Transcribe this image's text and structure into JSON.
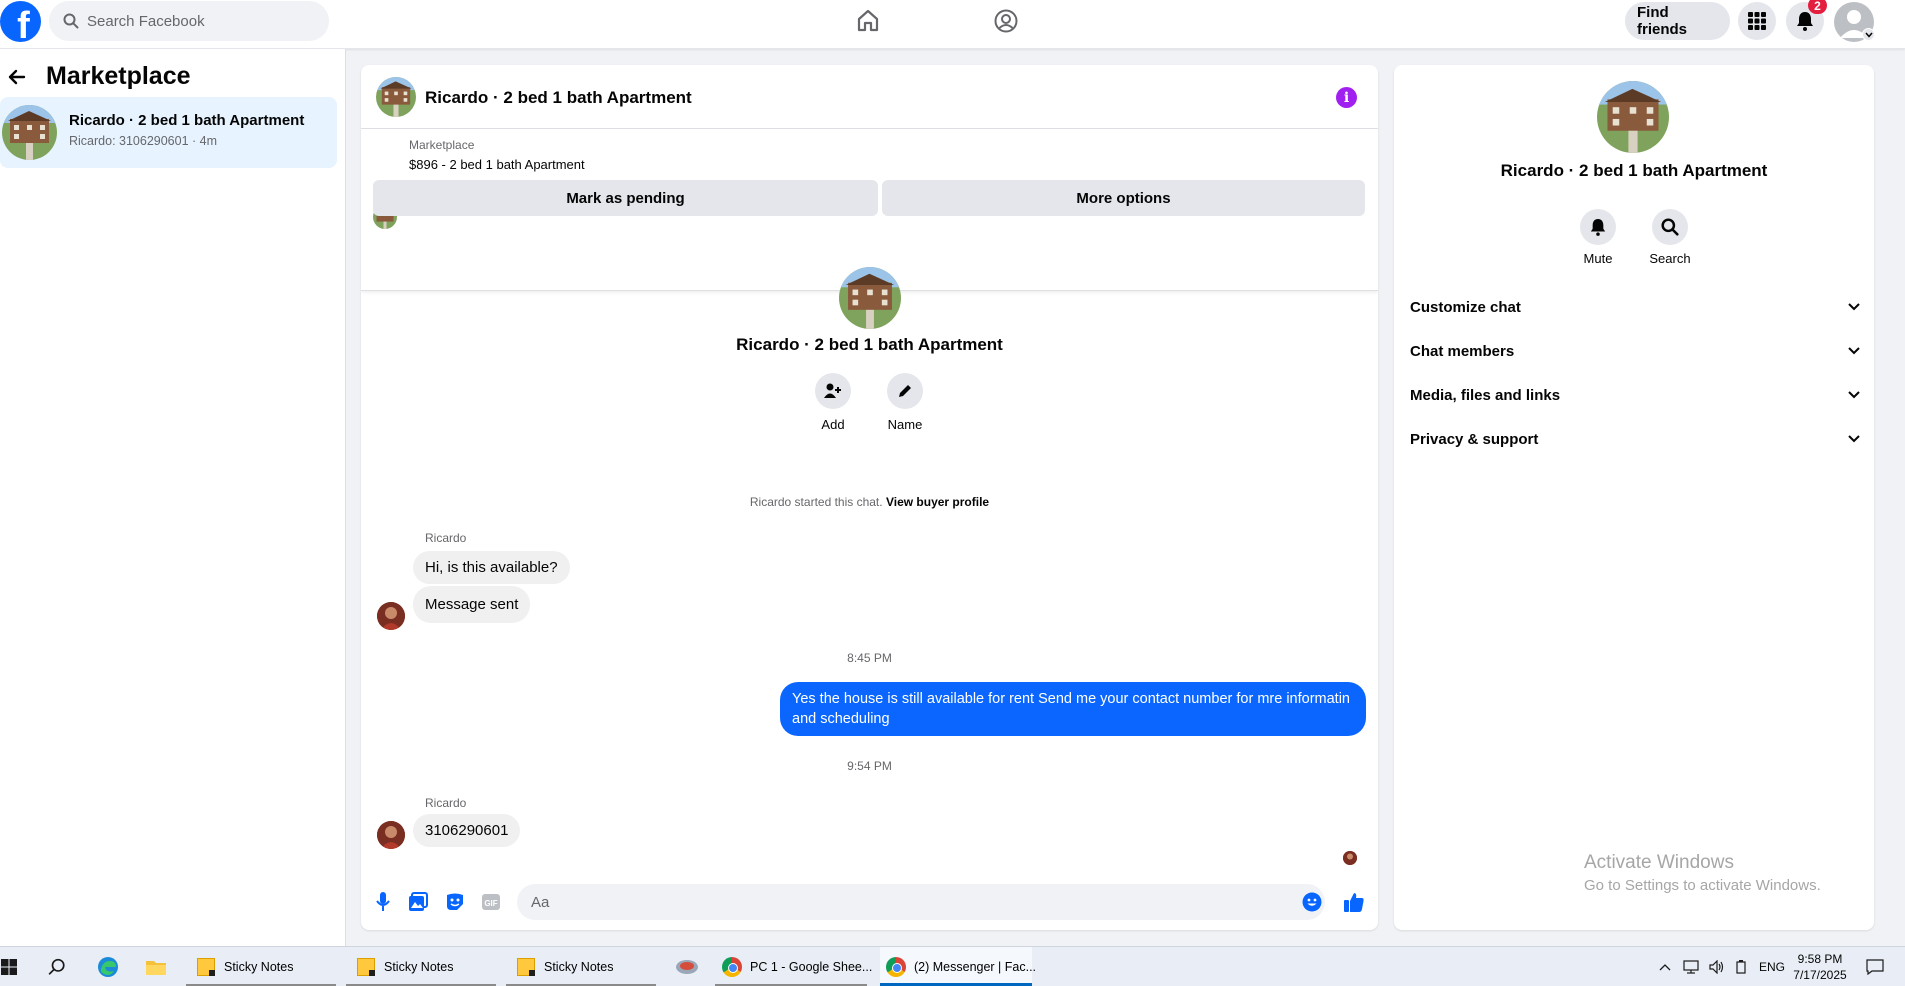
{
  "topbar": {
    "logo": "f",
    "search_placeholder": "Search Facebook",
    "find_friends": "Find friends",
    "notifications_count": "2"
  },
  "sidebar": {
    "title": "Marketplace",
    "conversations": [
      {
        "name": "Ricardo · 2 bed 1 bath Apartment",
        "subtitle": "Ricardo: 3106290601 · 4m"
      }
    ]
  },
  "chat": {
    "title": "Ricardo · 2 bed 1 bath Apartment",
    "info_icon": "i",
    "listing": {
      "source": "Marketplace",
      "price_title": "$896 - 2 bed 1 bath Apartment",
      "mark_pending": "Mark as pending",
      "more_options": "More options"
    },
    "intro": {
      "name": "Ricardo · 2 bed 1 bath Apartment",
      "add_label": "Add",
      "name_label": "Name"
    },
    "system_text": "Ricardo started this chat.",
    "system_link": "View buyer profile",
    "messages": [
      {
        "sender": "Ricardo",
        "text": "Hi, is this available?"
      },
      {
        "text": "Message sent"
      },
      {
        "time": "8:45 PM"
      },
      {
        "text": "Yes the house is still available for rent Send me your contact number for mre informatin and  scheduling"
      },
      {
        "time": "9:54 PM"
      },
      {
        "sender": "Ricardo",
        "text": "3106290601"
      }
    ],
    "composer_placeholder": "Aa"
  },
  "details": {
    "name": "Ricardo · 2 bed 1 bath Apartment",
    "mute": "Mute",
    "search": "Search",
    "sections": [
      "Customize chat",
      "Chat members",
      "Media, files and links",
      "Privacy & support"
    ]
  },
  "watermark": {
    "line1": "Activate Windows",
    "line2": "Go to Settings to activate Windows."
  },
  "taskbar": {
    "apps": [
      "Sticky Notes",
      "Sticky Notes",
      "Sticky Notes",
      "PC 1 - Google Shee...",
      "(2) Messenger | Fac..."
    ],
    "language": "ENG",
    "time": "9:58 PM",
    "date": "7/17/2025"
  },
  "colors": {
    "brand": "#0866ff",
    "outgoing_bubble": "#0a66ff",
    "info_icon": "#a020f0",
    "badge": "#e41e3f"
  }
}
